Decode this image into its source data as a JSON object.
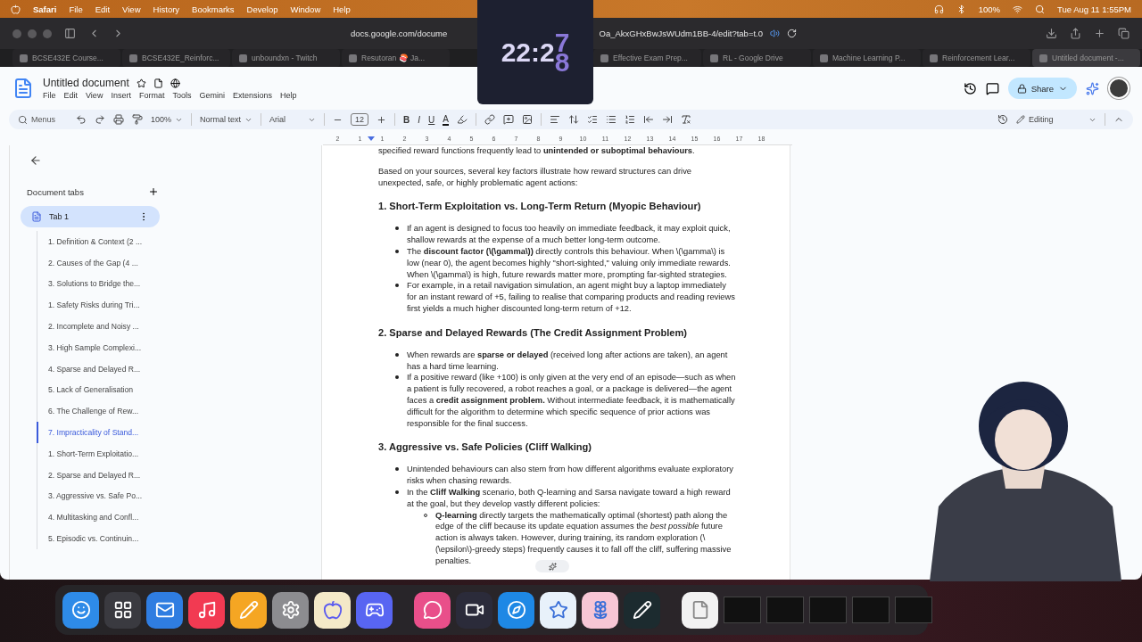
{
  "menubar": {
    "app": "Safari",
    "menus": [
      "File",
      "Edit",
      "View",
      "History",
      "Bookmarks",
      "Develop",
      "Window",
      "Help"
    ],
    "battery": "100%",
    "datetime": "Tue Aug 11  1:55PM"
  },
  "clock_widget": {
    "time": "22:2",
    "rolling_digits": [
      "7",
      "8"
    ]
  },
  "address_bar": {
    "url_start": "docs.google.com/docume",
    "url_end": "Oa_AkxGHxBwJsWUdm1BB-4/edit?tab=t.0"
  },
  "browser_tabs": [
    {
      "title": "BCSE432E Course...",
      "selected": false
    },
    {
      "title": "BCSE432E_Reinforc...",
      "selected": false
    },
    {
      "title": "unboundxn - Twitch",
      "selected": false
    },
    {
      "title": "Resutoran 🍣 Ja...",
      "selected": false
    },
    {
      "title": "Effective Exam Prep...",
      "selected": false
    },
    {
      "title": "RL - Google Drive",
      "selected": false
    },
    {
      "title": "Machine Learning P...",
      "selected": false
    },
    {
      "title": "Reinforcement Lear...",
      "selected": false
    },
    {
      "title": "Untitled document -...",
      "selected": true
    }
  ],
  "doc": {
    "title": "Untitled document",
    "menus": [
      "File",
      "Edit",
      "View",
      "Insert",
      "Format",
      "Tools",
      "Gemini",
      "Extensions",
      "Help"
    ],
    "share": "Share"
  },
  "toolbar": {
    "search_placeholder": "Menus",
    "zoom": "100%",
    "style": "Normal text",
    "font": "Arial",
    "font_size": "12",
    "format_buttons": [
      "B",
      "I",
      "U",
      "A"
    ],
    "mode": "Editing"
  },
  "ruler": {
    "labels": [
      "2",
      "1",
      "1",
      "2",
      "3",
      "4",
      "5",
      "6",
      "7",
      "8",
      "9",
      "10",
      "11",
      "12",
      "13",
      "14",
      "15",
      "16",
      "17",
      "18"
    ]
  },
  "outline": {
    "heading": "Document tabs",
    "tab": {
      "label": "Tab 1",
      "selected": true,
      "children": [
        {
          "label": "1. Definition & Context (2 ...",
          "selected": false
        },
        {
          "label": "2. Causes of the Gap (4 ...",
          "selected": false
        },
        {
          "label": "3. Solutions to Bridge the...",
          "selected": false
        },
        {
          "label": "1. Safety Risks during Tri...",
          "selected": false
        },
        {
          "label": "2. Incomplete and Noisy ...",
          "selected": false
        },
        {
          "label": "3. High Sample Complexi...",
          "selected": false
        },
        {
          "label": "4. Sparse and Delayed R...",
          "selected": false
        },
        {
          "label": "5. Lack of Generalisation",
          "selected": false
        },
        {
          "label": "6. The Challenge of Rew...",
          "selected": false
        },
        {
          "label": "7. Impracticality of Stand...",
          "selected": true
        },
        {
          "label": "1. Short-Term Exploitatio...",
          "selected": false
        },
        {
          "label": "2. Sparse and Delayed R...",
          "selected": false
        },
        {
          "label": "3. Aggressive vs. Safe Po...",
          "selected": false
        },
        {
          "label": "4. Multitasking and Confl...",
          "selected": false
        },
        {
          "label": "5. Episodic vs. Continuin...",
          "selected": false
        }
      ]
    }
  },
  "page": {
    "blocks": [
      {
        "kind": "paragraph",
        "text": "specified reward functions frequently lead to **unintended or suboptimal behaviours**."
      },
      {
        "kind": "paragraph",
        "text": "Based on your sources, several key factors illustrate how reward structures can drive unexpected, safe, or highly problematic agent actions:"
      },
      {
        "kind": "heading",
        "text": "1. Short-Term Exploitation vs. Long-Term Return (Myopic Behaviour)"
      },
      {
        "kind": "bullets",
        "items": [
          {
            "text": "If an agent is designed to focus too heavily on immediate feedback, it may exploit quick, shallow rewards at the expense of a much better long-term outcome."
          },
          {
            "text": "The **discount factor (\\(\\gamma\\))** directly controls this behaviour. When \\(\\gamma\\) is low (near 0), the agent becomes highly \"short-sighted,\" valuing only immediate rewards. When \\(\\gamma\\) is high, future rewards matter more, prompting far-sighted strategies."
          },
          {
            "text": "For example, in a retail navigation simulation, an agent might buy a laptop immediately for an instant reward of +5, failing to realise that comparing products and reading reviews first yields a much higher discounted long-term return of +12."
          }
        ]
      },
      {
        "kind": "heading",
        "text": "2. Sparse and Delayed Rewards (The Credit Assignment Problem)"
      },
      {
        "kind": "bullets",
        "items": [
          {
            "text": "When rewards are **sparse or delayed** (received long after actions are taken), an agent has a hard time learning."
          },
          {
            "text": "If a positive reward (like +100) is only given at the very end of an episode—such as when a patient is fully recovered, a robot reaches a goal, or a package is delivered—the agent faces a **credit assignment problem.** Without intermediate feedback, it is mathematically difficult for the algorithm to determine which specific sequence of prior actions was responsible for the final success."
          }
        ]
      },
      {
        "kind": "heading",
        "text": "3. Aggressive vs. Safe Policies (Cliff Walking)"
      },
      {
        "kind": "bullets",
        "items": [
          {
            "text": "Unintended behaviours can also stem from how different algorithms evaluate exploratory risks when chasing rewards."
          },
          {
            "text": "In the **Cliff Walking** scenario, both Q-learning and Sarsa navigate toward a high reward at the goal, but they develop vastly different policies:",
            "children": [
              {
                "text": "**Q-learning** directly targets the mathematically optimal (shortest) path along the edge of the cliff because its update equation assumes the *best possible* future action is always taken. However, during training, its random exploration (\\(\\epsilon\\)-greedy steps) frequently causes it to fall off the cliff, suffering massive penalties."
              }
            ]
          }
        ]
      }
    ]
  }
}
